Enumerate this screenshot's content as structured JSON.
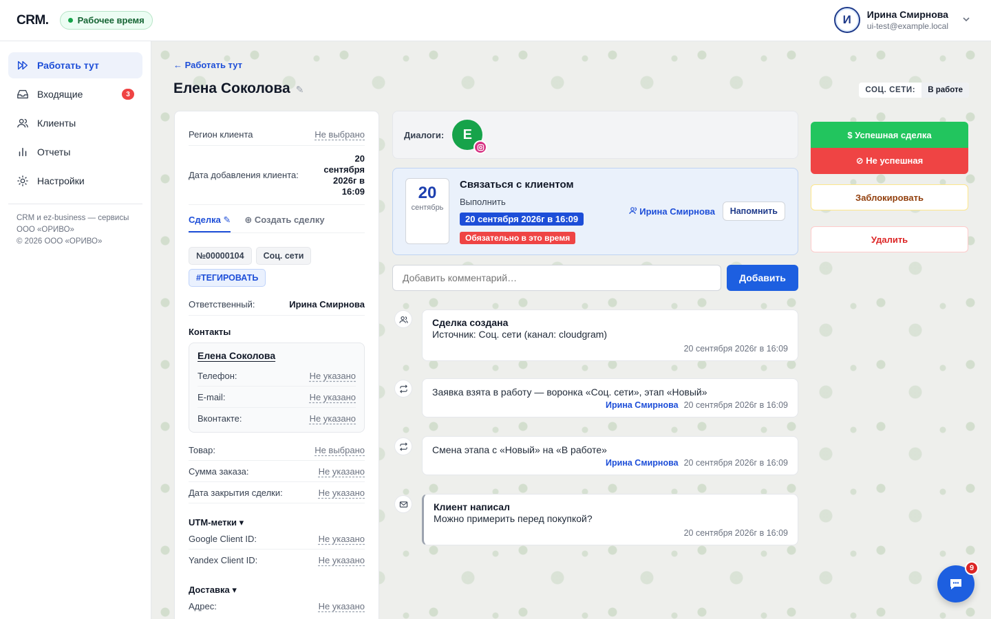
{
  "header": {
    "logo": "CRM.",
    "work_status": "Рабочее время",
    "user": {
      "initial": "И",
      "name": "Ирина Смирнова",
      "email": "ui-test@example.local"
    }
  },
  "sidebar": {
    "items": [
      {
        "label": "Работать тут",
        "icon": "fast-forward-icon",
        "active": true
      },
      {
        "label": "Входящие",
        "icon": "inbox-icon",
        "badge": "3"
      },
      {
        "label": "Клиенты",
        "icon": "users-icon"
      },
      {
        "label": "Отчеты",
        "icon": "bar-chart-icon"
      },
      {
        "label": "Настройки",
        "icon": "gear-icon"
      }
    ],
    "footer": [
      "CRM и ez-business — сервисы",
      "ООО «ОРИВО»",
      "© 2026 ООО «ОРИВО»"
    ]
  },
  "page": {
    "back": "← Работать тут",
    "title": "Елена Соколова",
    "status_key": "СОЦ. СЕТИ:",
    "status_value": "В работе"
  },
  "client": {
    "region_label": "Регион клиента",
    "region_value": "Не выбрано",
    "added_label": "Дата добавления клиента:",
    "added_value": "20 сентября 2026г в 16:09",
    "tab_deal": "Сделка ✎",
    "tab_create": "⊕ Создать сделку",
    "chips": [
      "№00000104",
      "Соц. сети"
    ],
    "tag": "#ТЕГИРОВАТЬ",
    "responsible_label": "Ответственный:",
    "responsible_value": "Ирина Смирнова",
    "contacts_title": "Контакты",
    "contact": {
      "name": "Елена Соколова",
      "phone_label": "Телефон:",
      "phone": "Не указано",
      "email_label": "E-mail:",
      "email": "Не указано",
      "vk_label": "Вконтакте:",
      "vk": "Не указано"
    },
    "product_label": "Товар:",
    "product": "Не выбрано",
    "sum_label": "Сумма заказа:",
    "sum": "Не указано",
    "close_label": "Дата закрытия сделки:",
    "close": "Не указано",
    "utm_title": "UTM-метки ▾",
    "gcid_label": "Google Client ID:",
    "gcid": "Не указано",
    "ycid_label": "Yandex Client ID:",
    "ycid": "Не указано",
    "delivery_title": "Доставка ▾",
    "address_label": "Адрес:",
    "address": "Не указано"
  },
  "dialogs": {
    "label": "Диалоги:",
    "avatar": "Е"
  },
  "task": {
    "day": "20",
    "month": "сентябрь",
    "title": "Связаться с клиентом",
    "sub": "Выполнить",
    "date": "20 сентября 2026г в 16:09",
    "must": "Обязательно в это время",
    "user": "Ирина Смирнова",
    "remind": "Напомнить"
  },
  "comment": {
    "placeholder": "Добавить комментарий…",
    "add": "Добавить"
  },
  "events": [
    {
      "title": "Сделка создана",
      "text": "Источник: Соц. сети (канал: cloudgram)",
      "who": "",
      "time": "20 сентября 2026г в 16:09"
    },
    {
      "title": "",
      "text": "Заявка взята в работу — воронка «Соц. сети», этап «Новый»",
      "who": "Ирина Смирнова",
      "time": "20 сентября 2026г в 16:09"
    },
    {
      "title": "",
      "text": "Смена этапа с «Новый» на «В работе»",
      "who": "Ирина Смирнова",
      "time": "20 сентября 2026г в 16:09"
    },
    {
      "title": "Клиент написал",
      "text": "Можно примерить перед покупкой?",
      "who": "",
      "time": "20 сентября 2026г в 16:09"
    }
  ],
  "actions": {
    "success": "$ Успешная сделка",
    "fail": "⊘ Не успешная",
    "block": "Заблокировать",
    "delete": "Удалить"
  },
  "chat": {
    "count": "9"
  }
}
